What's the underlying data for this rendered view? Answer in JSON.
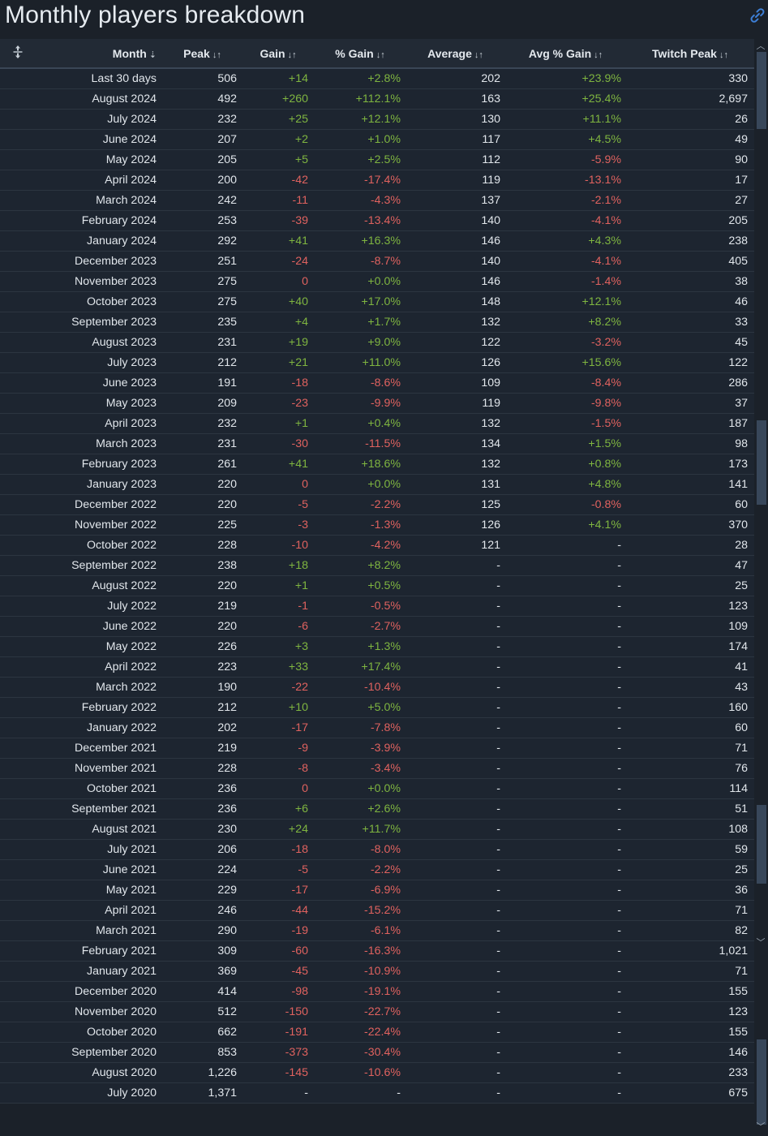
{
  "title": "Monthly players breakdown",
  "icons": {
    "link": "link-icon",
    "drag": "resize-vertical-icon"
  },
  "headers": [
    "Month",
    "Peak",
    "Gain",
    "% Gain",
    "Average",
    "Avg % Gain",
    "Twitch Peak"
  ],
  "sort_glyphs": {
    "active": "⇂⃗",
    "inactive": "↓↑"
  },
  "colors": {
    "positive": "#7fb540",
    "negative": "#e0625f",
    "background": "#1b2129"
  },
  "rows": [
    [
      "Last 30 days",
      "506",
      "+14",
      "+2.8%",
      "202",
      "+23.9%",
      "330"
    ],
    [
      "August 2024",
      "492",
      "+260",
      "+112.1%",
      "163",
      "+25.4%",
      "2,697"
    ],
    [
      "July 2024",
      "232",
      "+25",
      "+12.1%",
      "130",
      "+11.1%",
      "26"
    ],
    [
      "June 2024",
      "207",
      "+2",
      "+1.0%",
      "117",
      "+4.5%",
      "49"
    ],
    [
      "May 2024",
      "205",
      "+5",
      "+2.5%",
      "112",
      "-5.9%",
      "90"
    ],
    [
      "April 2024",
      "200",
      "-42",
      "-17.4%",
      "119",
      "-13.1%",
      "17"
    ],
    [
      "March 2024",
      "242",
      "-11",
      "-4.3%",
      "137",
      "-2.1%",
      "27"
    ],
    [
      "February 2024",
      "253",
      "-39",
      "-13.4%",
      "140",
      "-4.1%",
      "205"
    ],
    [
      "January 2024",
      "292",
      "+41",
      "+16.3%",
      "146",
      "+4.3%",
      "238"
    ],
    [
      "December 2023",
      "251",
      "-24",
      "-8.7%",
      "140",
      "-4.1%",
      "405"
    ],
    [
      "November 2023",
      "275",
      "0",
      "+0.0%",
      "146",
      "-1.4%",
      "38"
    ],
    [
      "October 2023",
      "275",
      "+40",
      "+17.0%",
      "148",
      "+12.1%",
      "46"
    ],
    [
      "September 2023",
      "235",
      "+4",
      "+1.7%",
      "132",
      "+8.2%",
      "33"
    ],
    [
      "August 2023",
      "231",
      "+19",
      "+9.0%",
      "122",
      "-3.2%",
      "45"
    ],
    [
      "July 2023",
      "212",
      "+21",
      "+11.0%",
      "126",
      "+15.6%",
      "122"
    ],
    [
      "June 2023",
      "191",
      "-18",
      "-8.6%",
      "109",
      "-8.4%",
      "286"
    ],
    [
      "May 2023",
      "209",
      "-23",
      "-9.9%",
      "119",
      "-9.8%",
      "37"
    ],
    [
      "April 2023",
      "232",
      "+1",
      "+0.4%",
      "132",
      "-1.5%",
      "187"
    ],
    [
      "March 2023",
      "231",
      "-30",
      "-11.5%",
      "134",
      "+1.5%",
      "98"
    ],
    [
      "February 2023",
      "261",
      "+41",
      "+18.6%",
      "132",
      "+0.8%",
      "173"
    ],
    [
      "January 2023",
      "220",
      "0",
      "+0.0%",
      "131",
      "+4.8%",
      "141"
    ],
    [
      "December 2022",
      "220",
      "-5",
      "-2.2%",
      "125",
      "-0.8%",
      "60"
    ],
    [
      "November 2022",
      "225",
      "-3",
      "-1.3%",
      "126",
      "+4.1%",
      "370"
    ],
    [
      "October 2022",
      "228",
      "-10",
      "-4.2%",
      "121",
      "-",
      "28"
    ],
    [
      "September 2022",
      "238",
      "+18",
      "+8.2%",
      "-",
      "-",
      "47"
    ],
    [
      "August 2022",
      "220",
      "+1",
      "+0.5%",
      "-",
      "-",
      "25"
    ],
    [
      "July 2022",
      "219",
      "-1",
      "-0.5%",
      "-",
      "-",
      "123"
    ],
    [
      "June 2022",
      "220",
      "-6",
      "-2.7%",
      "-",
      "-",
      "109"
    ],
    [
      "May 2022",
      "226",
      "+3",
      "+1.3%",
      "-",
      "-",
      "174"
    ],
    [
      "April 2022",
      "223",
      "+33",
      "+17.4%",
      "-",
      "-",
      "41"
    ],
    [
      "March 2022",
      "190",
      "-22",
      "-10.4%",
      "-",
      "-",
      "43"
    ],
    [
      "February 2022",
      "212",
      "+10",
      "+5.0%",
      "-",
      "-",
      "160"
    ],
    [
      "January 2022",
      "202",
      "-17",
      "-7.8%",
      "-",
      "-",
      "60"
    ],
    [
      "December 2021",
      "219",
      "-9",
      "-3.9%",
      "-",
      "-",
      "71"
    ],
    [
      "November 2021",
      "228",
      "-8",
      "-3.4%",
      "-",
      "-",
      "76"
    ],
    [
      "October 2021",
      "236",
      "0",
      "+0.0%",
      "-",
      "-",
      "114"
    ],
    [
      "September 2021",
      "236",
      "+6",
      "+2.6%",
      "-",
      "-",
      "51"
    ],
    [
      "August 2021",
      "230",
      "+24",
      "+11.7%",
      "-",
      "-",
      "108"
    ],
    [
      "July 2021",
      "206",
      "-18",
      "-8.0%",
      "-",
      "-",
      "59"
    ],
    [
      "June 2021",
      "224",
      "-5",
      "-2.2%",
      "-",
      "-",
      "25"
    ],
    [
      "May 2021",
      "229",
      "-17",
      "-6.9%",
      "-",
      "-",
      "36"
    ],
    [
      "April 2021",
      "246",
      "-44",
      "-15.2%",
      "-",
      "-",
      "71"
    ],
    [
      "March 2021",
      "290",
      "-19",
      "-6.1%",
      "-",
      "-",
      "82"
    ],
    [
      "February 2021",
      "309",
      "-60",
      "-16.3%",
      "-",
      "-",
      "1,021"
    ],
    [
      "January 2021",
      "369",
      "-45",
      "-10.9%",
      "-",
      "-",
      "71"
    ],
    [
      "December 2020",
      "414",
      "-98",
      "-19.1%",
      "-",
      "-",
      "155"
    ],
    [
      "November 2020",
      "512",
      "-150",
      "-22.7%",
      "-",
      "-",
      "123"
    ],
    [
      "October 2020",
      "662",
      "-191",
      "-22.4%",
      "-",
      "-",
      "155"
    ],
    [
      "September 2020",
      "853",
      "-373",
      "-30.4%",
      "-",
      "-",
      "146"
    ],
    [
      "August 2020",
      "1,226",
      "-145",
      "-10.6%",
      "-",
      "-",
      "233"
    ],
    [
      "July 2020",
      "1,371",
      "-",
      "-",
      "-",
      "-",
      "675"
    ]
  ]
}
